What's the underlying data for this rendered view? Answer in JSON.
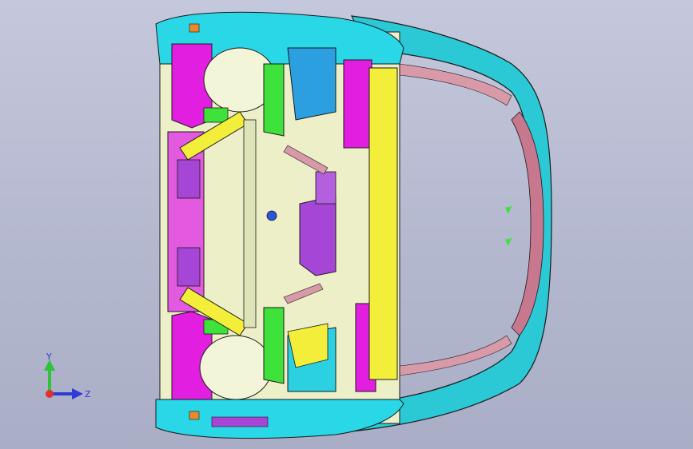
{
  "viewport": {
    "background_top": "#c5c8dc",
    "background_bottom": "#a9aec6"
  },
  "model": {
    "colors": {
      "magenta": "#e21fe0",
      "pale": "#ecefc8",
      "cyan": "#29d7e6",
      "green": "#3fe23a",
      "yellow": "#f2ee3a",
      "violet": "#a546d6",
      "pink": "#c8788e",
      "orange": "#e8892b",
      "blue": "#1e6fd8",
      "outline": "#1a1a1a"
    }
  },
  "triad": {
    "y_label": "Y",
    "z_label": "Z",
    "y_color": "#2fc23a",
    "z_color": "#2e3bd6",
    "origin_color": "#e03030"
  }
}
